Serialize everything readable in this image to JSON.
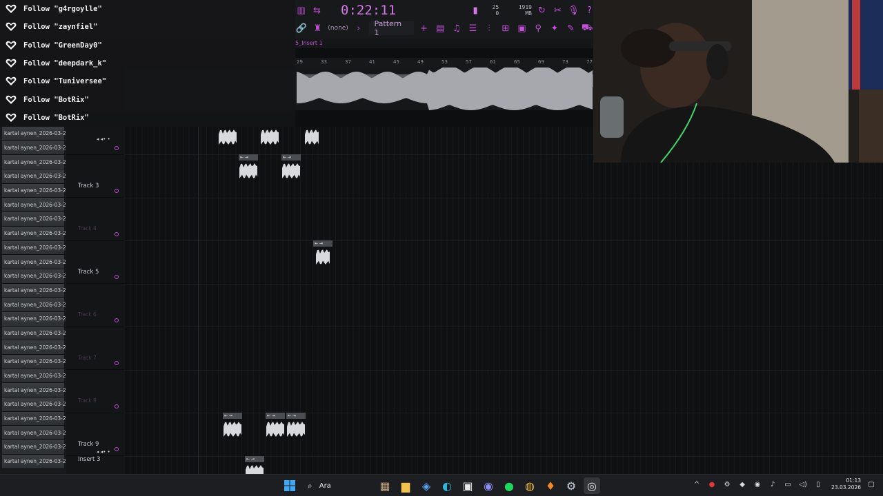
{
  "follow_alerts": [
    {
      "text": "Follow \"g4rgoylle\""
    },
    {
      "text": "Follow \"zaynfiel\""
    },
    {
      "text": "Follow \"GreenDay0\""
    },
    {
      "text": "Follow \"deepdark_k\""
    },
    {
      "text": "Follow \"Tuniversee\""
    },
    {
      "text": "Follow \"BotRix\""
    },
    {
      "text": "Follow \"BotRix\""
    }
  ],
  "toolbar": {
    "time": "0:22:11",
    "cpu_top": "25",
    "memory": "1919 MB",
    "cpu_bottom": "0",
    "pattern": "Pattern 1",
    "none_label": "(none)",
    "breadcrumb": "5_Insert 1"
  },
  "ruler": {
    "ticks": [
      "29",
      "33",
      "37",
      "41",
      "45",
      "49",
      "53",
      "57",
      "61",
      "65",
      "69",
      "73",
      "77"
    ]
  },
  "browser": {
    "items": [
      "kartal aynen_2026-03-2...",
      "kartal aynen_2026-03-2...",
      "kartal aynen_2026-03-2...",
      "kartal aynen_2026-03-2...",
      "kartal aynen_2026-03-2...",
      "kartal aynen_2026-03-2...",
      "kartal aynen_2026-03-2...",
      "kartal aynen_2026-03-2...",
      "kartal aynen_2026-03-2...",
      "kartal aynen_2026-03-2...",
      "kartal aynen_2026-03-2...",
      "kartal aynen_2026-03-2...",
      "kartal aynen_2026-03-2...",
      "kartal aynen_2026-03-2...",
      "kartal aynen_2026-03-2...",
      "kartal aynen_2026-03-2...",
      "kartal aynen_2026-03-2...",
      "kartal aynen_2026-03-2...",
      "kartal aynen_2026-03-2...",
      "kartal aynen_2026-03-2...",
      "kartal aynen_2026-03-2...",
      "kartal aynen_2026-03-2...",
      "kartal aynen_2026-03-2...",
      "kartal aynen_2026-03-2..."
    ]
  },
  "tracks": [
    {
      "label": "",
      "dim": false
    },
    {
      "label": "Track 3",
      "dim": false
    },
    {
      "label": "Track 4",
      "dim": true
    },
    {
      "label": "Track 5",
      "dim": false
    },
    {
      "label": "Track 6",
      "dim": true
    },
    {
      "label": "Track 7",
      "dim": true
    },
    {
      "label": "Track 8",
      "dim": true
    },
    {
      "label": "Track 9",
      "dim": false
    }
  ],
  "insert_label": "Insert 3",
  "taskbar": {
    "search_label": "Ara",
    "time": "01:13",
    "date": "23.03.2026"
  },
  "colors": {
    "accent": "#c44fd9",
    "background": "#0d0e0f",
    "clip_header": "#4a4d52"
  }
}
